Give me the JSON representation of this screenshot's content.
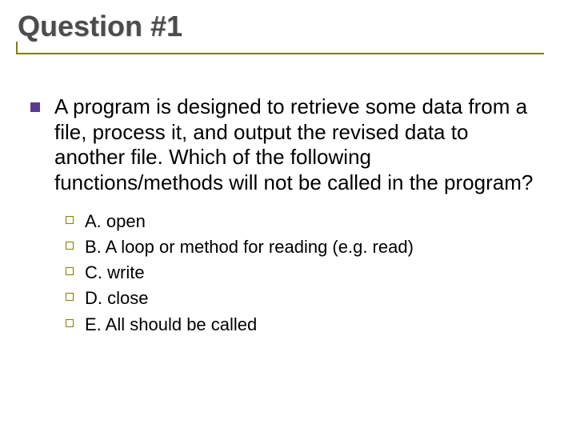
{
  "title": "Question #1",
  "question": "A program is designed to retrieve some data from a file, process it, and output the revised data to another file. Which of the following functions/methods will not be called in the program?",
  "options": {
    "a": "A. open",
    "b": "B. A loop or method for reading (e.g. read)",
    "c": "C. write",
    "d": "D. close",
    "e": "E. All should be called"
  }
}
